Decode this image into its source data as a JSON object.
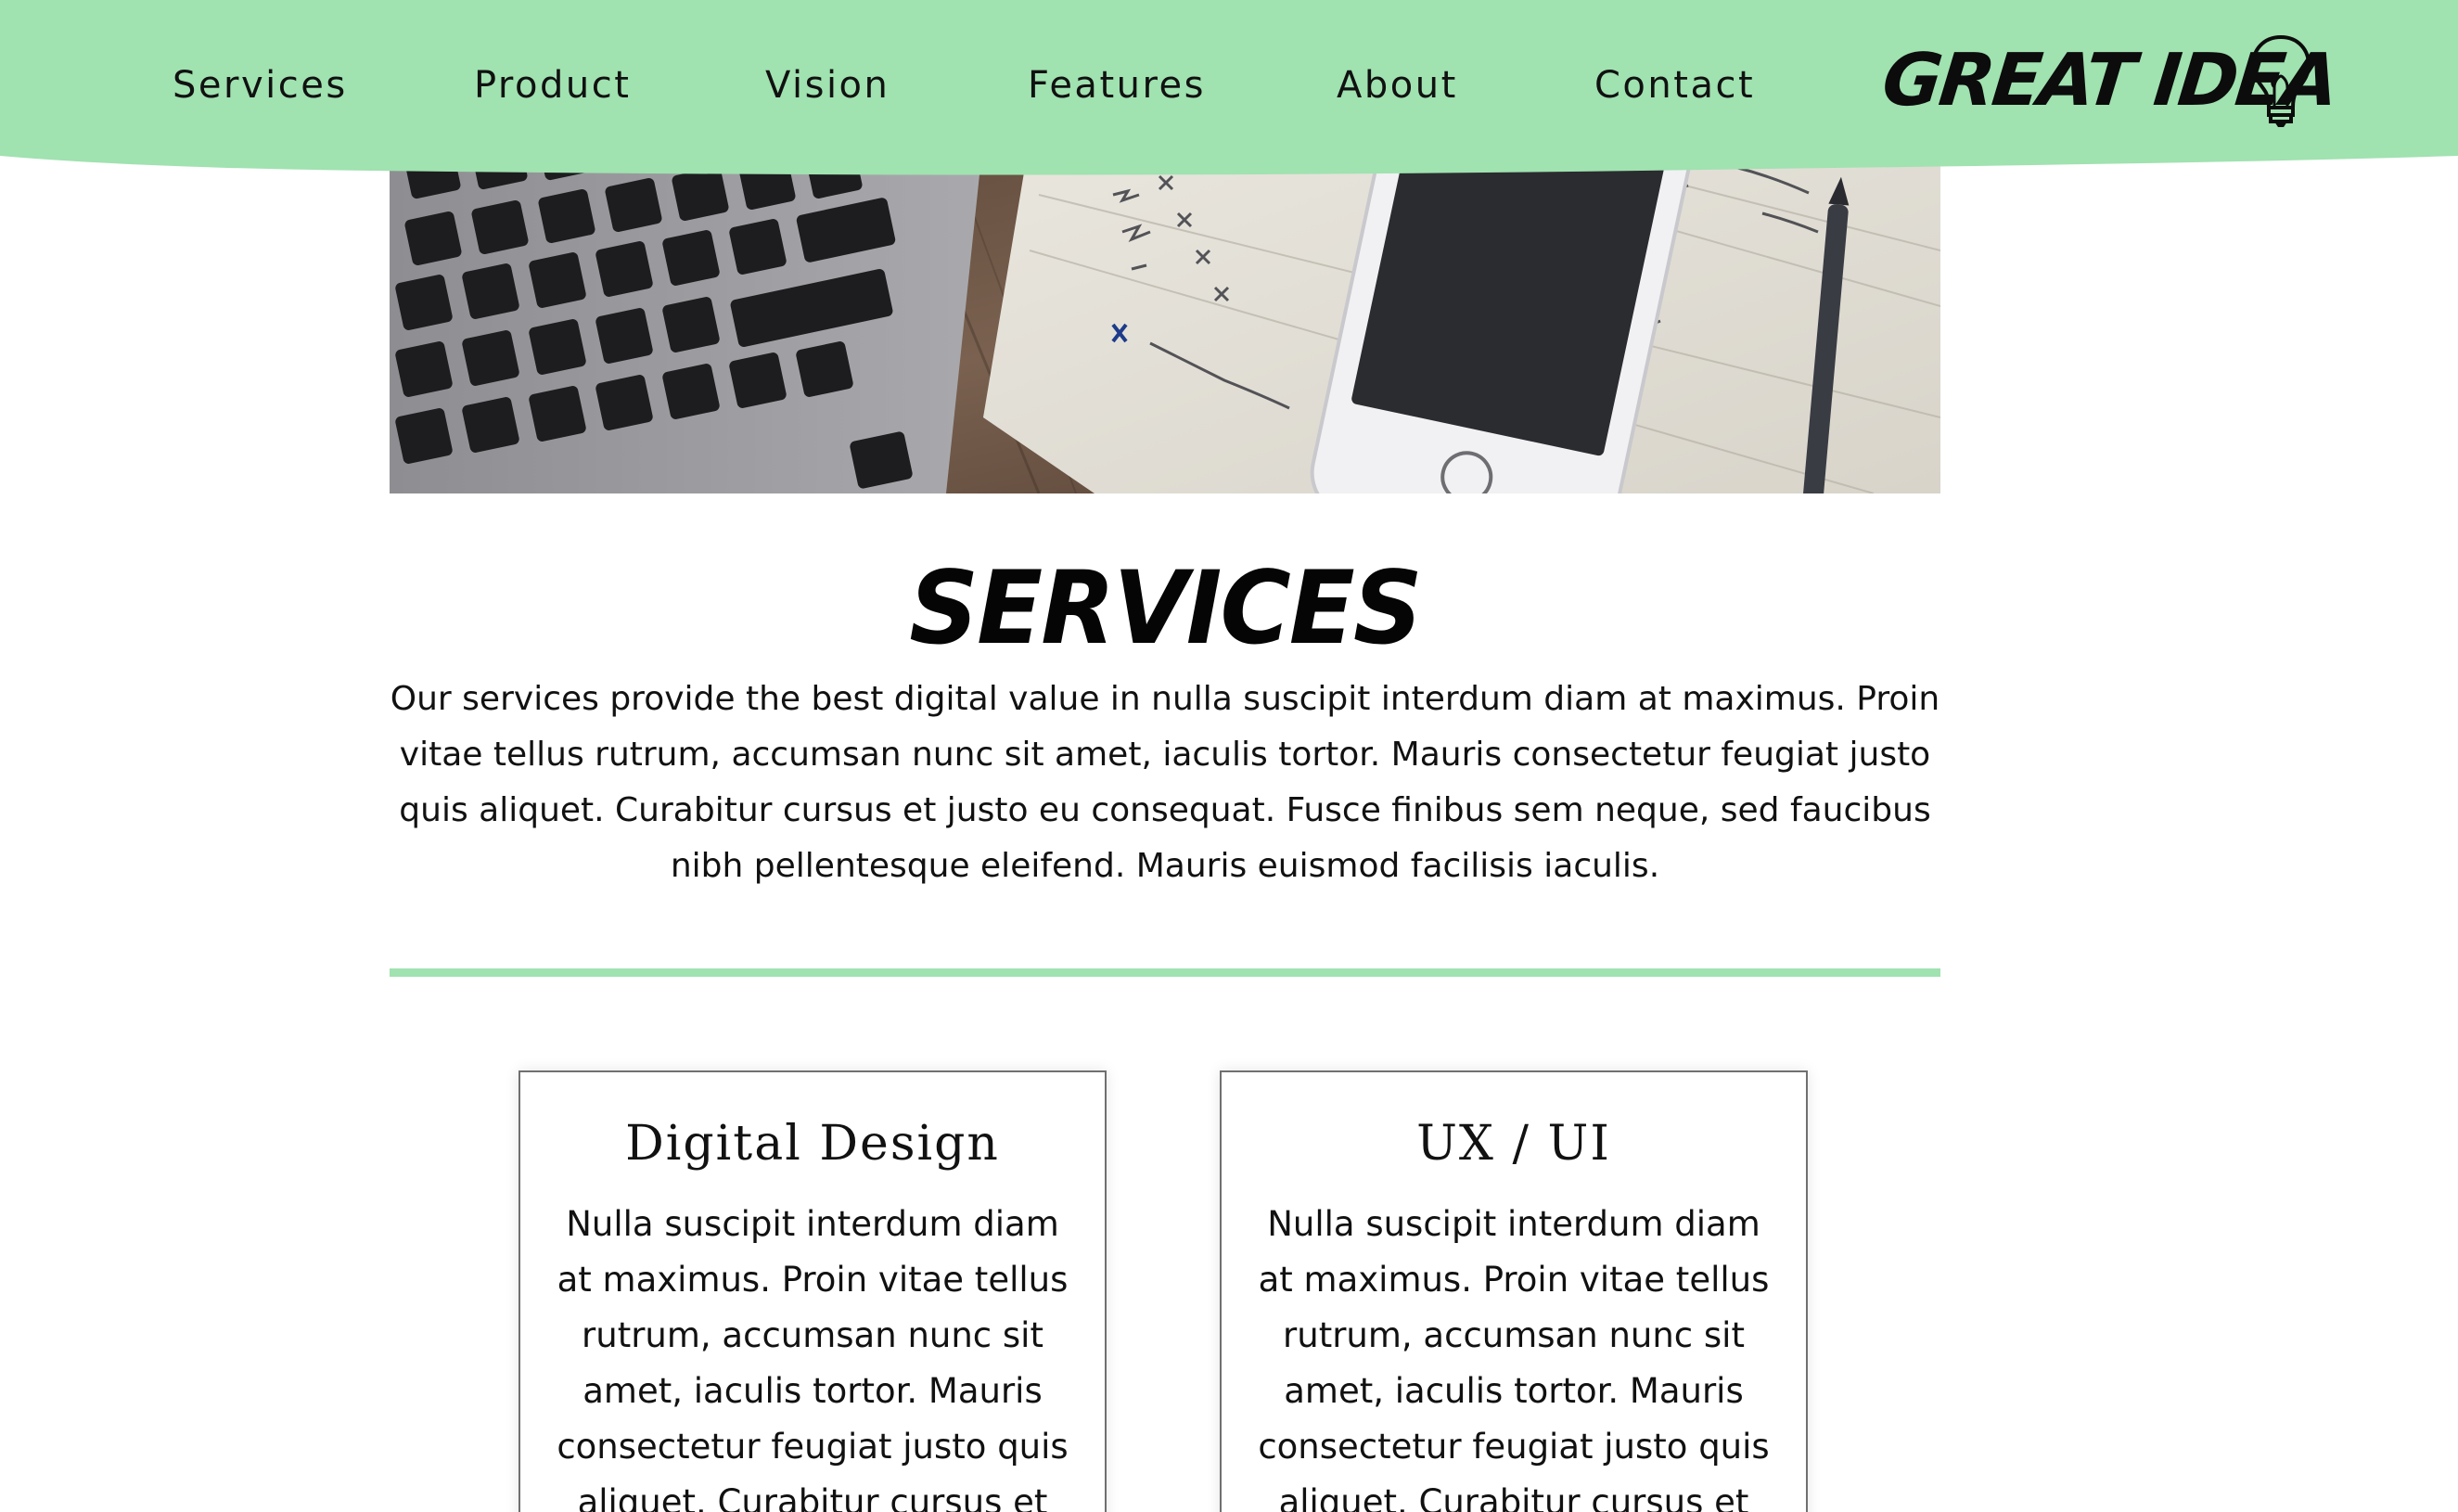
{
  "nav": {
    "items": [
      {
        "label": "Services"
      },
      {
        "label": "Product"
      },
      {
        "label": "Vision"
      },
      {
        "label": "Features"
      },
      {
        "label": "About"
      },
      {
        "label": "Contact"
      }
    ]
  },
  "logo": {
    "text": "GREAT IDEA",
    "icon": "lightbulb-icon"
  },
  "hero": {
    "image": "laptop-keyboard-phone-notebook-photo"
  },
  "services": {
    "title": "SERVICES",
    "intro": "Our services provide the best digital value in nulla suscipit interdum diam at maximus. Proin vitae tellus rutrum, accumsan nunc sit amet, iaculis tortor. Mauris consectetur feugiat justo quis aliquet. Curabitur cursus et justo eu consequat. Fusce finibus sem neque, sed faucibus nibh pellentesque eleifend. Mauris euismod facilisis iaculis.",
    "cards": [
      {
        "title": "Digital Design",
        "text": "Nulla suscipit interdum diam at maximus. Proin vitae tellus rutrum, accumsan nunc sit amet, iaculis tortor. Mauris consectetur feugiat justo quis aliquet. Curabitur cursus et justo eu"
      },
      {
        "title": "UX / UI",
        "text": "Nulla suscipit interdum diam at maximus. Proin vitae tellus rutrum, accumsan nunc sit amet, iaculis tortor. Mauris consectetur feugiat justo quis aliquet. Curabitur cursus et justo eu"
      }
    ]
  },
  "colors": {
    "header_green": "#a0e2b0",
    "divider_green": "#a0e2b0",
    "text": "#111111",
    "card_border": "#707070"
  }
}
